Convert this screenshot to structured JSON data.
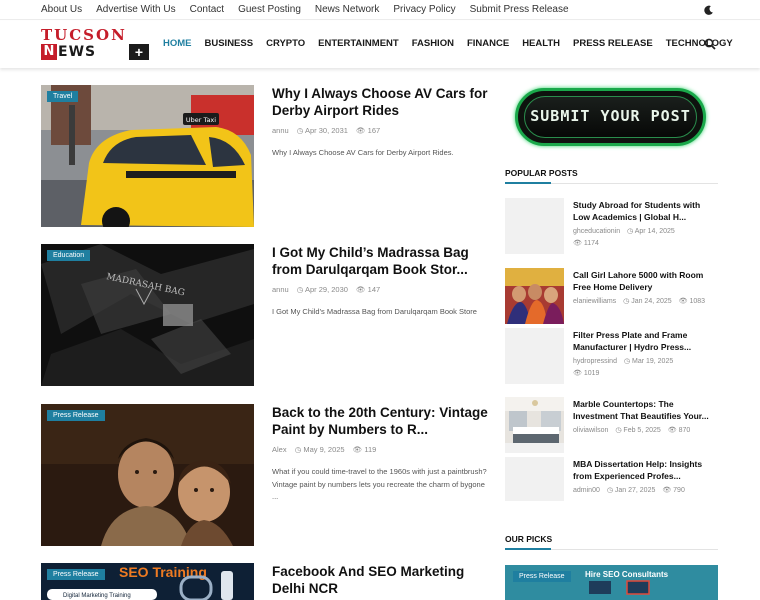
{
  "topbar": {
    "links": [
      "About Us",
      "Advertise With Us",
      "Contact",
      "Guest Posting",
      "News Network",
      "Privacy Policy",
      "Submit Press Release"
    ],
    "theme_icon": "moon-icon"
  },
  "logo": {
    "top": "TUCSON",
    "n": "N",
    "rest": "EWS",
    "plus": "+"
  },
  "nav": {
    "items": [
      "HOME",
      "BUSINESS",
      "CRYPTO",
      "ENTERTAINMENT",
      "FASHION",
      "FINANCE",
      "HEALTH",
      "PRESS RELEASE",
      "TECHNOLOGY"
    ],
    "active": "HOME",
    "search_icon": "search-icon"
  },
  "posts": [
    {
      "category": "Travel",
      "title": "Why I Always Choose AV Cars for Derby Airport Rides",
      "author": "annu",
      "date": "Apr 30, 2031",
      "views": "167",
      "excerpt": "Why I Always Choose AV Cars for Derby Airport Rides."
    },
    {
      "category": "Education",
      "title": "I Got My Child’s Madrassa Bag from Darulqarqam Book Stor...",
      "author": "annu",
      "date": "Apr 29, 2030",
      "views": "147",
      "excerpt": "I Got My Child’s Madrassa Bag from Darulqarqam Book Store"
    },
    {
      "category": "Press Release",
      "title": "Back to the 20th Century: Vintage Paint by Numbers to R...",
      "author": "Alex",
      "date": "May 9, 2025",
      "views": "119",
      "excerpt": "What if you could time-travel to the 1960s with just a paintbrush? Vintage paint by numbers lets you recreate the charm of bygone ..."
    },
    {
      "category": "Press Release",
      "title": "Facebook And SEO Marketing Delhi NCR",
      "author": "",
      "date": "",
      "views": "",
      "excerpt": ""
    }
  ],
  "thumb_text": {
    "taxi_sign": "Uber Taxi",
    "bag_label": "MADRASAH BAG",
    "seo_banner": "SEO Training",
    "seo_sub": "Digital Marketing Training"
  },
  "sidebar": {
    "submit_label": "SUBMIT YOUR POST",
    "popular_title": "POPULAR POSTS",
    "picks_title": "OUR PICKS",
    "popular": [
      {
        "title": "Study Abroad for Students with Low Academics | Global H...",
        "author": "ghceducationin",
        "date": "Apr 14, 2025",
        "views": "1174"
      },
      {
        "title": "Call Girl Lahore 5000 with Room Free Home Delivery",
        "author": "elaniewilliams",
        "date": "Jan 24, 2025",
        "views": "1083"
      },
      {
        "title": "Filter Press Plate and Frame Manufacturer | Hydro Press...",
        "author": "hydropressind",
        "date": "Mar 19, 2025",
        "views": "1019"
      },
      {
        "title": "Marble Countertops: The Investment That Beautifies Your...",
        "author": "oliviawilson",
        "date": "Feb 5, 2025",
        "views": "870"
      },
      {
        "title": "MBA Dissertation Help: Insights from Experienced Profes...",
        "author": "admin00",
        "date": "Jan 27, 2025",
        "views": "790"
      }
    ],
    "pick": {
      "category": "Press Release",
      "text": "Hire SEO Consultants"
    }
  },
  "colors": {
    "accent": "#1f7fa0",
    "logo_red": "#c51d2a",
    "submit_green": "#1aa84a"
  }
}
